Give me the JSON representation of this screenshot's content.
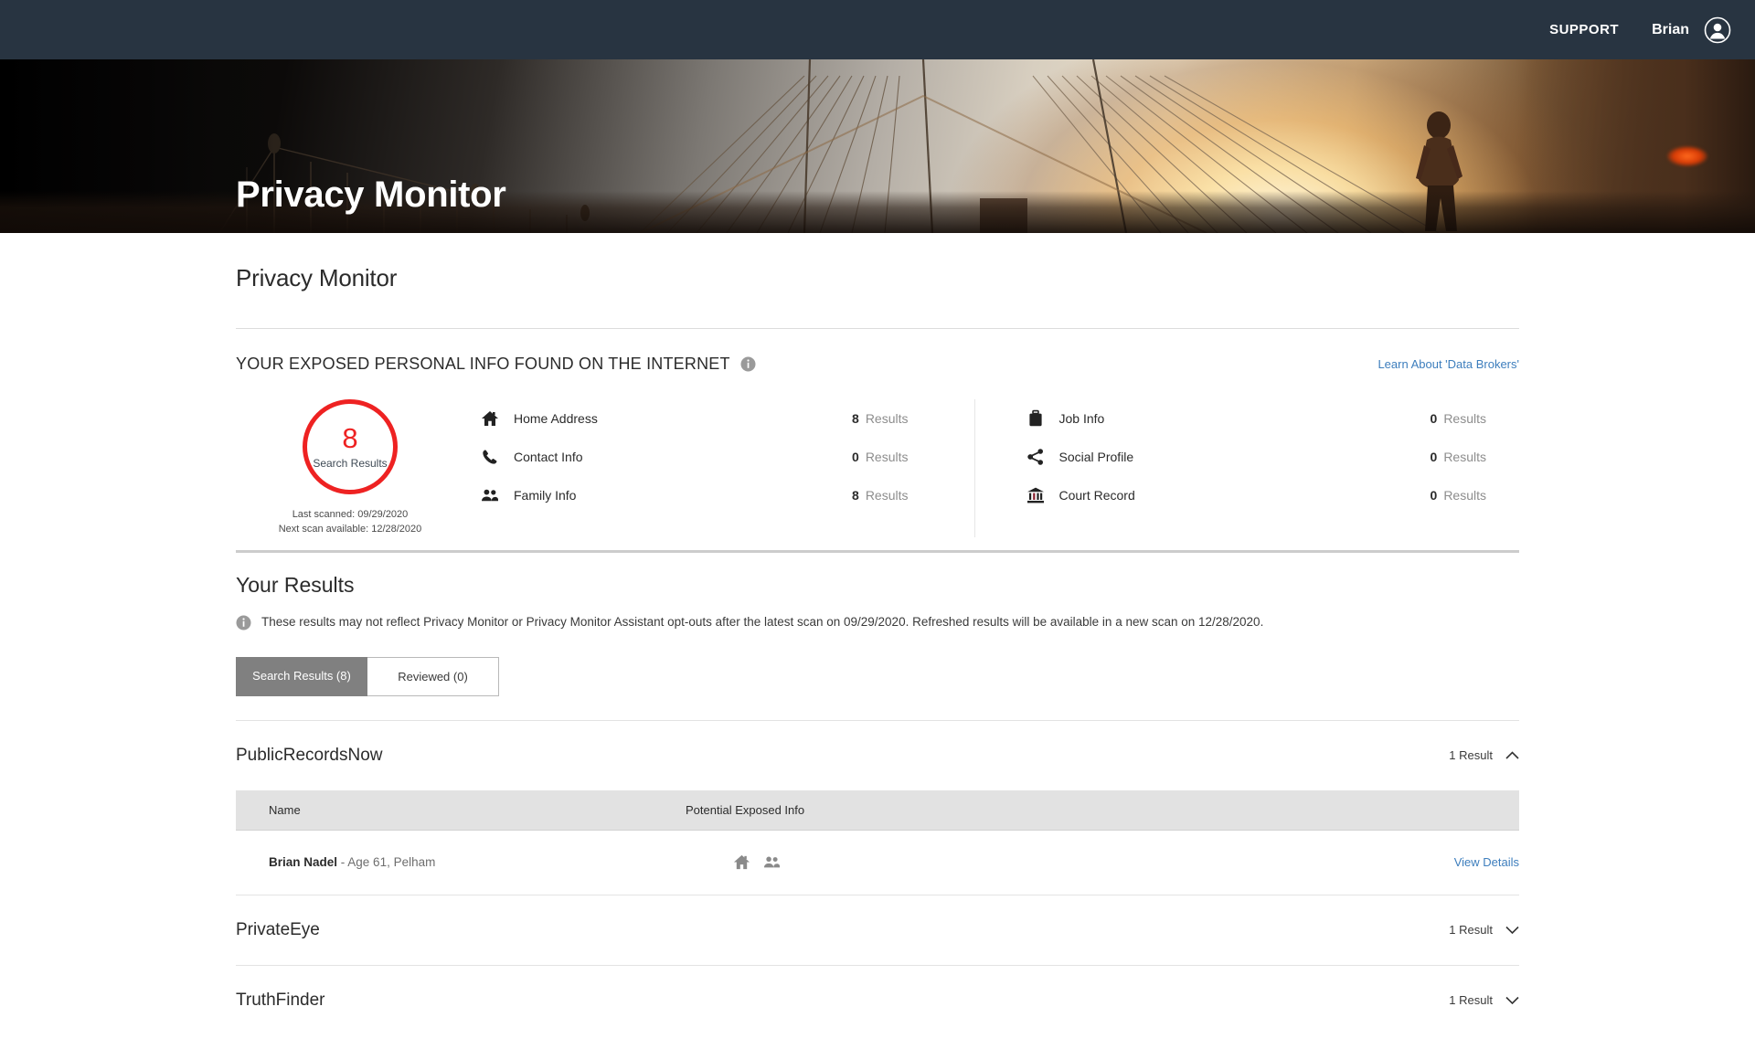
{
  "topbar": {
    "support_label": "SUPPORT",
    "user_name": "Brian",
    "avatar_icon": "user-avatar-icon"
  },
  "hero": {
    "title": "Privacy Monitor"
  },
  "page": {
    "title": "Privacy Monitor"
  },
  "summary": {
    "heading": "YOUR EXPOSED PERSONAL INFO FOUND ON THE INTERNET",
    "heading_info_icon": "info-icon",
    "learn_link": "Learn About 'Data Brokers'",
    "score": {
      "number": "8",
      "caption": "Search Results",
      "last_scanned": "Last scanned: 09/29/2020",
      "next_scan": "Next scan available: 12/28/2020",
      "accent_color": "#ee2222"
    },
    "categories_left": [
      {
        "icon": "home-icon",
        "label": "Home Address",
        "count": "8",
        "unit": "Results"
      },
      {
        "icon": "phone-icon",
        "label": "Contact Info",
        "count": "0",
        "unit": "Results"
      },
      {
        "icon": "family-icon",
        "label": "Family Info",
        "count": "8",
        "unit": "Results"
      }
    ],
    "categories_right": [
      {
        "icon": "briefcase-icon",
        "label": "Job Info",
        "count": "0",
        "unit": "Results"
      },
      {
        "icon": "share-icon",
        "label": "Social Profile",
        "count": "0",
        "unit": "Results"
      },
      {
        "icon": "courthouse-icon",
        "label": "Court Record",
        "count": "0",
        "unit": "Results"
      }
    ]
  },
  "results": {
    "title": "Your Results",
    "notice_icon": "info-icon",
    "notice": "These results may not reflect Privacy Monitor or Privacy Monitor Assistant opt-outs after the latest scan on 09/29/2020. Refreshed results will be available in a new scan on 12/28/2020.",
    "tabs": [
      {
        "label": "Search Results (8)",
        "active": true
      },
      {
        "label": "Reviewed (0)",
        "active": false
      }
    ],
    "columns": {
      "name": "Name",
      "exposed": "Potential Exposed Info"
    },
    "brokers": [
      {
        "name": "PublicRecordsNow",
        "count": "1 Result",
        "expanded": true,
        "chevron": "chevron-up-icon",
        "rows": [
          {
            "name_bold": "Brian Nadel",
            "name_rest": " - Age 61, Pelham",
            "exposed_icons": [
              "home-icon",
              "family-icon"
            ],
            "action": "View Details"
          }
        ]
      },
      {
        "name": "PrivateEye",
        "count": "1 Result",
        "expanded": false,
        "chevron": "chevron-down-icon",
        "rows": []
      },
      {
        "name": "TruthFinder",
        "count": "1 Result",
        "expanded": false,
        "chevron": "chevron-down-icon",
        "rows": []
      }
    ]
  },
  "colors": {
    "topbar_bg": "#283441",
    "accent_red": "#ee2222",
    "link_blue": "#3d7ebd",
    "tab_active_bg": "#808080",
    "table_header_bg": "#e2e2e2"
  }
}
